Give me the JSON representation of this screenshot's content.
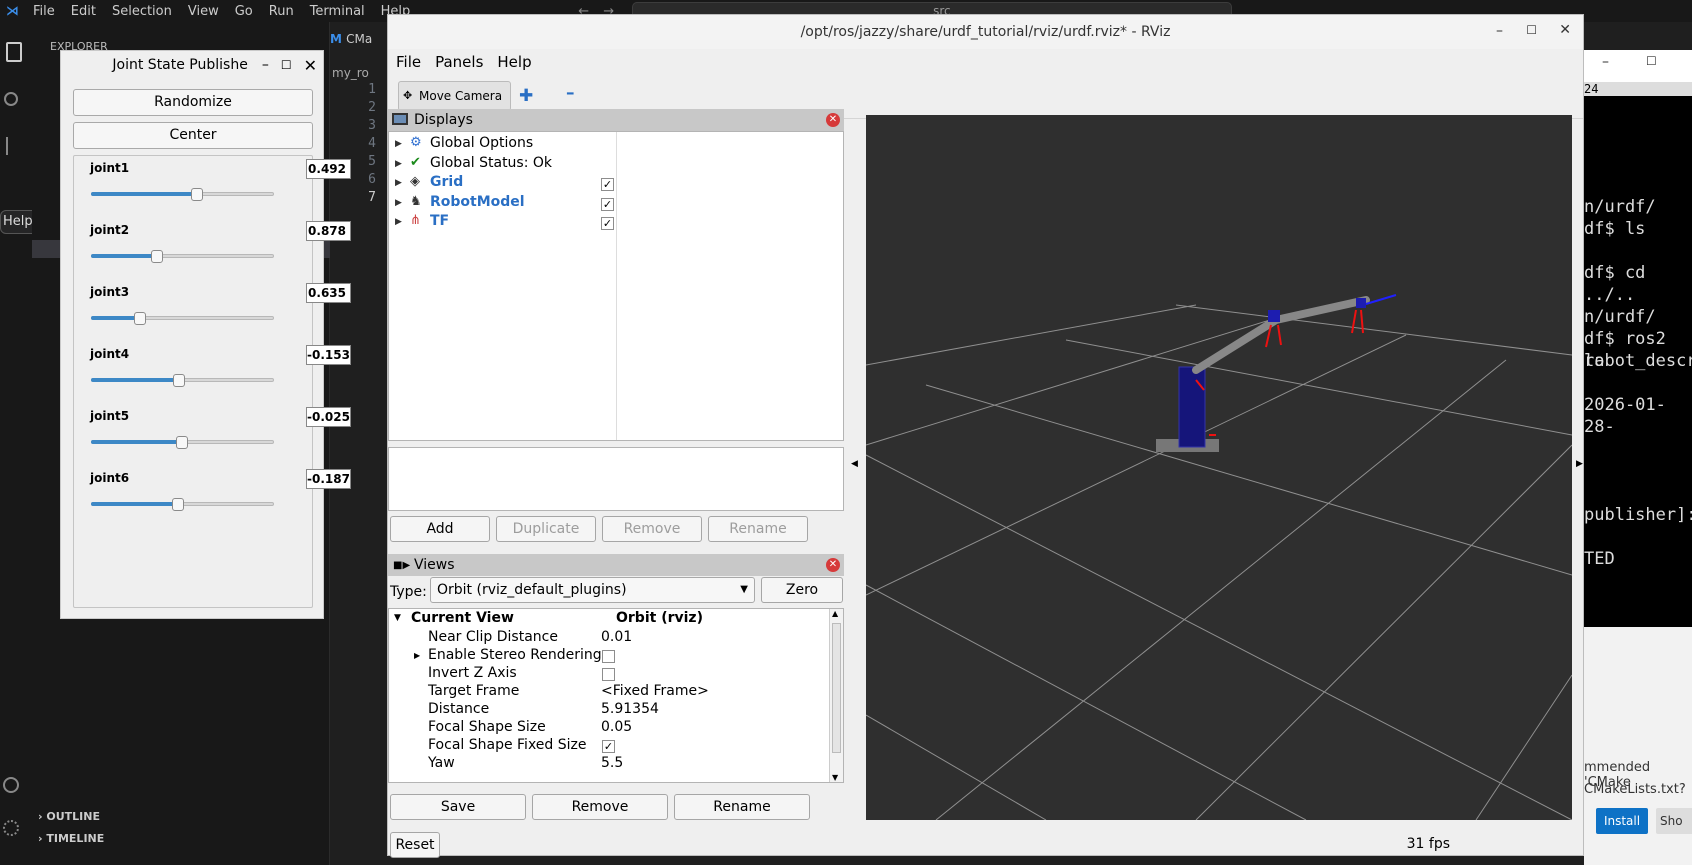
{
  "vscode": {
    "menu": [
      "File",
      "Edit",
      "Selection",
      "View",
      "Go",
      "Run",
      "Terminal",
      "Help"
    ],
    "search_text": "src",
    "explorer_label": "EXPLORER",
    "tab_label": "CMa",
    "breadcrumb": "my_ro",
    "line_numbers": [
      "1",
      "2",
      "3",
      "4",
      "5",
      "6",
      "7"
    ],
    "help_tooltip": "Help",
    "outline": "OUTLINE",
    "timeline": "TIMELINE"
  },
  "terminal": {
    "lines": [
      "n/urdf/",
      "df$ ls",
      "",
      "df$ cd ../..",
      "",
      "n/urdf/",
      "df$ ros2 la",
      "robot_descr",
      "",
      "2026-01-28-",
      "",
      "",
      "",
      "",
      "publisher]:",
      "",
      "TED"
    ],
    "top_text": "24",
    "notification": [
      "mmended 'CMake",
      "CMakeLists.txt?"
    ],
    "install_label": "Install",
    "show_label": "Sho"
  },
  "jsp": {
    "title": "Joint State Publishe",
    "randomize": "Randomize",
    "center": "Center",
    "joints": [
      {
        "name": "joint1",
        "value": "0.492",
        "pos": 0.58
      },
      {
        "name": "joint2",
        "value": "0.878",
        "pos": 0.36
      },
      {
        "name": "joint3",
        "value": "0.635",
        "pos": 0.27
      },
      {
        "name": "joint4",
        "value": "-0.153",
        "pos": 0.48
      },
      {
        "name": "joint5",
        "value": "-0.025",
        "pos": 0.495
      },
      {
        "name": "joint6",
        "value": "-0.187",
        "pos": 0.475
      }
    ]
  },
  "rviz": {
    "title": "/opt/ros/jazzy/share/urdf_tutorial/rviz/urdf.rviz* - RViz",
    "menu": [
      "File",
      "Panels",
      "Help"
    ],
    "tool_move": "Move Camera",
    "displays_title": "Displays",
    "displays": [
      {
        "label": "Global Options",
        "bold": false,
        "check": null
      },
      {
        "label": "Global Status: Ok",
        "bold": false,
        "check": null
      },
      {
        "label": "Grid",
        "bold": true,
        "check": true
      },
      {
        "label": "RobotModel",
        "bold": true,
        "check": true
      },
      {
        "label": "TF",
        "bold": true,
        "check": true
      }
    ],
    "disp_buttons": [
      "Add",
      "Duplicate",
      "Remove",
      "Rename"
    ],
    "views_title": "Views",
    "type_label": "Type:",
    "type_value": "Orbit (rviz_default_plugins)",
    "zero": "Zero",
    "view_head": [
      "Current View",
      "Orbit (rviz)"
    ],
    "view_props": [
      [
        "Near Clip Distance",
        "0.01"
      ],
      [
        "Enable Stereo Rendering",
        ""
      ],
      [
        "Invert Z Axis",
        ""
      ],
      [
        "Target Frame",
        "<Fixed Frame>"
      ],
      [
        "Distance",
        "5.91354"
      ],
      [
        "Focal Shape Size",
        "0.05"
      ],
      [
        "Focal Shape Fixed Size",
        ""
      ],
      [
        "Yaw",
        "5.5"
      ]
    ],
    "view_buttons": [
      "Save",
      "Remove",
      "Rename"
    ],
    "reset": "Reset",
    "fps": "31 fps"
  }
}
